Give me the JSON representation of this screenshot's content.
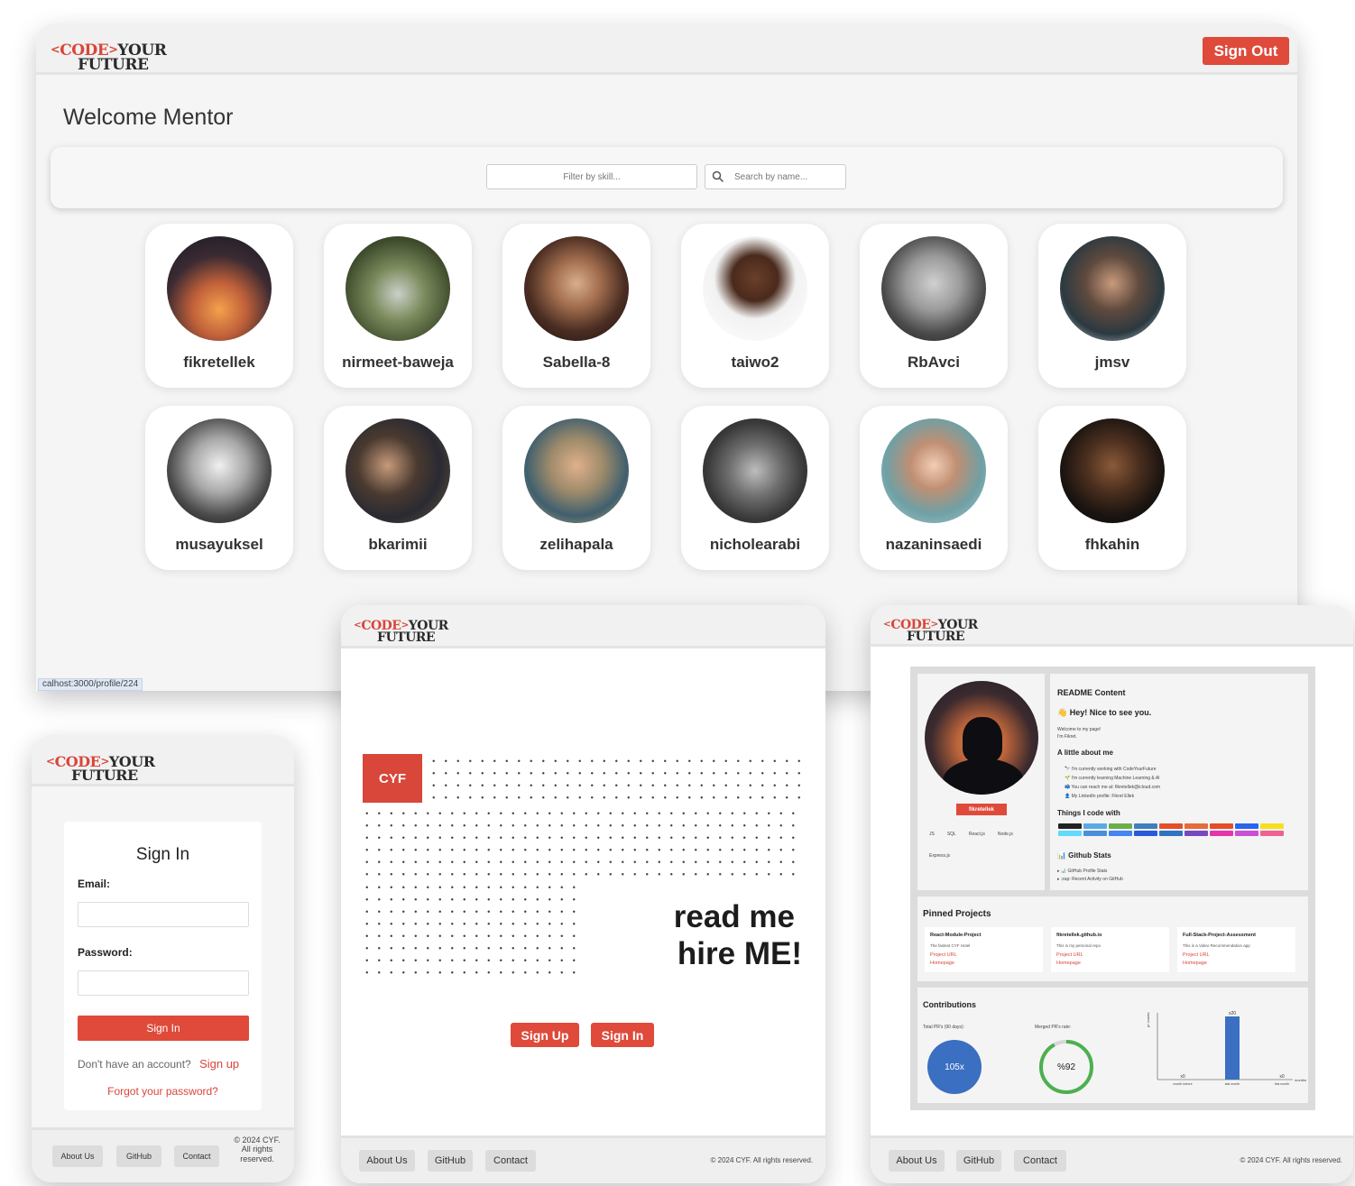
{
  "logo": {
    "lt": "<",
    "code": "CODE",
    "gt": ">",
    "your": "YOUR",
    "future": "FUTURE"
  },
  "main": {
    "sign_out": "Sign Out",
    "welcome": "Welcome Mentor",
    "filter_placeholder": "Filter by skill...",
    "search_placeholder": "Search by name...",
    "status_url": "calhost:3000/profile/224",
    "users": [
      "fikretellek",
      "nirmeet-baweja",
      "Sabella-8",
      "taiwo2",
      "RbAvci",
      "jmsv",
      "musayuksel",
      "bkarimii",
      "zelihapala",
      "nicholearabi",
      "nazaninsaedi",
      "fhkahin"
    ]
  },
  "signin": {
    "title": "Sign In",
    "email_label": "Email:",
    "password_label": "Password:",
    "button": "Sign In",
    "no_account": "Don't have an account?",
    "sign_up": "Sign up",
    "forgot": "Forgot your password?",
    "footer": {
      "about": "About Us",
      "github": "GitHub",
      "contact": "Contact",
      "copyright": "© 2024 CYF. All rights reserved."
    }
  },
  "landing": {
    "cyf": "CYF",
    "tagline1": "read me",
    "tagline2": "hire ME!",
    "sign_up": "Sign Up",
    "sign_in": "Sign In",
    "footer": {
      "about": "About Us",
      "github": "GitHub",
      "contact": "Contact",
      "copyright": "© 2024 CYF. All rights reserved."
    }
  },
  "profile": {
    "username_badge": "fikretellek",
    "skills": [
      "JS",
      "SQL",
      "React.js",
      "Node.js",
      "Express.js"
    ],
    "readme_title": "README Content",
    "greeting": "👋 Hey! Nice to see you.",
    "welcome_line": "Welcome to my page!",
    "im_line": "I'm Fikret.",
    "about_title": "A little about me",
    "about_lines": [
      "🔭 I'm currently working with  CodeYourFuture",
      "🌱 I'm currently learning Machine Learning & AI",
      "📫 You can reach me at:  fikretellek@icloud.com",
      "👤 My LinkedIn profile:  Fikret Ellek"
    ],
    "things_title": "Things I code with",
    "stats_title": "📊 Github Stats",
    "stats_lines": [
      "▸ 📊 GitHub Profile Stats",
      "▸ :zap: Recent Activity on GitHub"
    ],
    "pinned_title": "Pinned Projects",
    "projects": [
      {
        "name": "React-Module-Project",
        "desc": "The fastest CYF Hotel",
        "url": "Project URL",
        "home": "Homepage"
      },
      {
        "name": "fikretellek.github.io",
        "desc": "This is my personal repo",
        "url": "Project URL",
        "home": "Homepage"
      },
      {
        "name": "Full-Stack-Project-Assessment",
        "desc": "This is a Video Recommendation app",
        "url": "Project URL",
        "home": "Homepage"
      }
    ],
    "contrib_title": "Contributions",
    "total_label": "Total PR's (90 days):",
    "total_value": "105x",
    "merged_label": "Merged PR's rate:",
    "merged_value": "%92",
    "merged_rate": 0.92,
    "chart_ylabel": "pr counts",
    "chart_xunit": "months",
    "bars": [
      {
        "label": "month before",
        "value": 0,
        "text": "x0"
      },
      {
        "label": "last month",
        "value": 20,
        "text": "x20"
      },
      {
        "label": "this month",
        "value": 0,
        "text": "x0"
      }
    ],
    "footer": {
      "about": "About Us",
      "github": "GitHub",
      "contact": "Contact",
      "copyright": "© 2024 CYF. All rights reserved."
    }
  },
  "colors": {
    "accent": "#df4a3a",
    "blue": "#3a6fc1",
    "green": "#4cb04e"
  }
}
